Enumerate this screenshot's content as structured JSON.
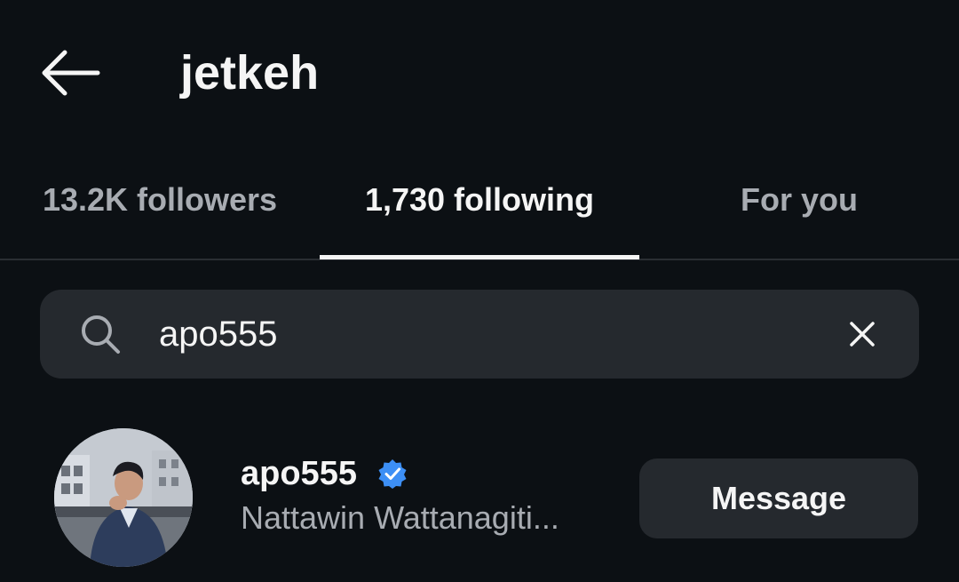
{
  "header": {
    "title": "jetkeh",
    "back_icon": "arrow-left-icon"
  },
  "tabs": [
    {
      "label": "13.2K followers",
      "selected": false
    },
    {
      "label": "1,730 following",
      "selected": true
    },
    {
      "label": "For you",
      "selected": false
    }
  ],
  "search": {
    "value": "apo555",
    "search_icon": "search-icon",
    "clear_icon": "close-icon"
  },
  "results": [
    {
      "username": "apo555",
      "verified": true,
      "full_name": "Nattawin Wattanagiti...",
      "action_label": "Message"
    }
  ],
  "colors": {
    "background": "#0c1014",
    "surface": "#25292e",
    "text_primary": "#f5f5f5",
    "text_secondary": "#a8acb2",
    "verified_blue": "#3d8ff5"
  }
}
